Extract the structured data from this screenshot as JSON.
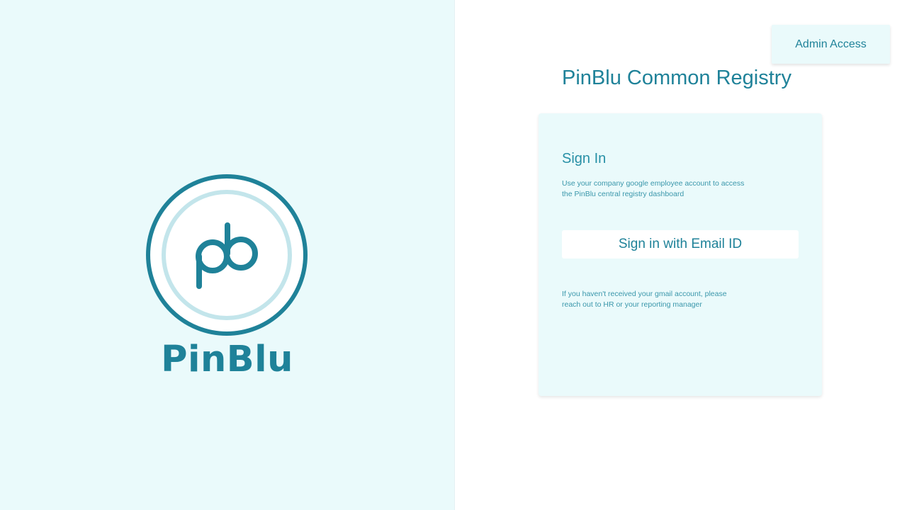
{
  "brand": {
    "name": "PinBlu",
    "logo_text": "pb",
    "primary_color": "#1f8299",
    "ring_light_color": "#c3e5eb",
    "panel_bg": "#eafafb"
  },
  "header": {
    "admin_button_label": "Admin Access",
    "app_title": "PinBlu Common Registry"
  },
  "signin": {
    "heading": "Sign In",
    "description": "Use your company google employee account to access the PinBlu central registry dashboard",
    "email_button_label": "Sign in with Email ID",
    "help_note": "If you haven't received your gmail account, please reach out to HR or your reporting manager"
  }
}
